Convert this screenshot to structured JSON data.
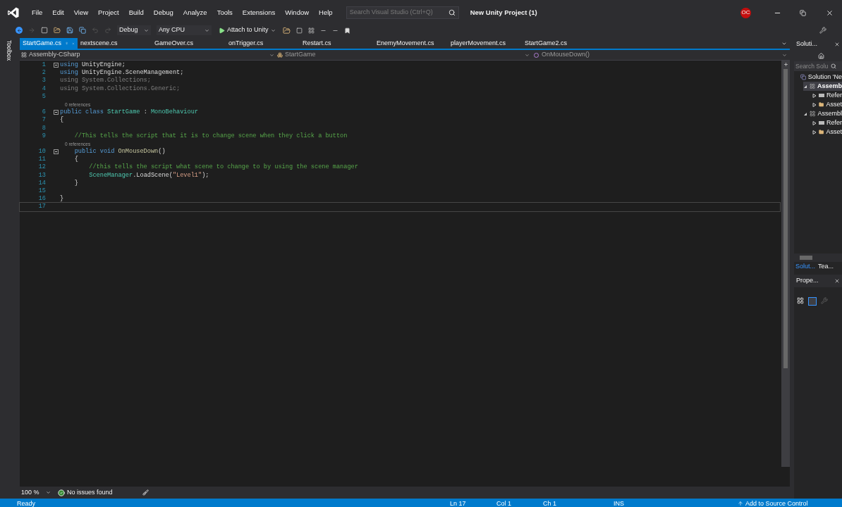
{
  "menu": [
    "File",
    "Edit",
    "View",
    "Project",
    "Build",
    "Debug",
    "Analyze",
    "Tools",
    "Extensions",
    "Window",
    "Help"
  ],
  "search": {
    "placeholder": "Search Visual Studio (Ctrl+Q)"
  },
  "window": {
    "title": "New Unity Project (1)"
  },
  "account": {
    "initials": "OC"
  },
  "toolbar": {
    "configuration": "Debug",
    "platform": "Any CPU",
    "run": "Attach to Unity"
  },
  "side_tab": "Toolbox",
  "tabs": [
    {
      "label": "StartGame.cs",
      "selected": true
    },
    {
      "label": "nextscene.cs",
      "selected": false
    },
    {
      "label": "GameOver.cs",
      "selected": false
    },
    {
      "label": "onTrigger.cs",
      "selected": false
    },
    {
      "label": "Restart.cs",
      "selected": false
    },
    {
      "label": "EnemyMovement.cs",
      "selected": false
    },
    {
      "label": "playerMovement.cs",
      "selected": false
    },
    {
      "label": "StartGame2.cs",
      "selected": false
    }
  ],
  "nav_bar": {
    "project": "Assembly-CSharp",
    "class": "StartGame",
    "member": "OnMouseDown()"
  },
  "code": [
    {
      "number": "1",
      "fold": true,
      "current": false,
      "tokens": [
        {
          "text": "using",
          "kind": "keyword"
        },
        {
          "text": " UnityEngine;",
          "kind": "plain"
        }
      ]
    },
    {
      "number": "2",
      "fold": false,
      "current": false,
      "tokens": [
        {
          "text": "using",
          "kind": "keyword"
        },
        {
          "text": " UnityEngine.SceneManagement;",
          "kind": "plain"
        }
      ]
    },
    {
      "number": "3",
      "fold": false,
      "current": false,
      "tokens": [
        {
          "text": "using System.Collections;",
          "kind": "unused"
        }
      ]
    },
    {
      "number": "4",
      "fold": false,
      "current": false,
      "tokens": [
        {
          "text": "using System.Collections.Generic;",
          "kind": "unused"
        }
      ]
    },
    {
      "number": "5",
      "fold": false,
      "current": false
    },
    {
      "number": "6",
      "fold": true,
      "current": false,
      "lens": "0 references",
      "tokens": [
        {
          "text": "public class ",
          "kind": "keyword"
        },
        {
          "text": "StartGame",
          "kind": "type"
        },
        {
          "text": " : ",
          "kind": "plain"
        },
        {
          "text": "MonoBehaviour",
          "kind": "type"
        }
      ]
    },
    {
      "number": "7",
      "fold": false,
      "current": false,
      "tokens": [
        {
          "text": "{",
          "kind": "plain"
        }
      ]
    },
    {
      "number": "8",
      "fold": false,
      "current": false
    },
    {
      "number": "9",
      "fold": false,
      "current": false,
      "tokens": [
        {
          "text": "    //This tells the script that it is to change scene when they click a button",
          "kind": "comment"
        }
      ]
    },
    {
      "number": "10",
      "fold": true,
      "current": false,
      "lens": "0 references",
      "tokens": [
        {
          "text": "    public void ",
          "kind": "keyword"
        },
        {
          "text": "OnMouseDown",
          "kind": "method"
        },
        {
          "text": "()",
          "kind": "plain"
        }
      ]
    },
    {
      "number": "11",
      "fold": false,
      "current": false,
      "tokens": [
        {
          "text": "    {",
          "kind": "plain"
        }
      ]
    },
    {
      "number": "12",
      "fold": false,
      "current": false,
      "tokens": [
        {
          "text": "        //this tells the script what scene to change to by using the scene manager",
          "kind": "comment"
        }
      ]
    },
    {
      "number": "13",
      "fold": false,
      "current": false,
      "tokens": [
        {
          "text": "        SceneManager",
          "kind": "type"
        },
        {
          "text": ".LoadScene(",
          "kind": "plain"
        },
        {
          "text": "\"Level1\"",
          "kind": "string"
        },
        {
          "text": ");",
          "kind": "plain"
        }
      ]
    },
    {
      "number": "14",
      "fold": false,
      "current": false,
      "tokens": [
        {
          "text": "    }",
          "kind": "plain"
        }
      ]
    },
    {
      "number": "15",
      "fold": false,
      "current": false
    },
    {
      "number": "16",
      "fold": false,
      "current": false,
      "tokens": [
        {
          "text": "}",
          "kind": "plain"
        }
      ]
    },
    {
      "number": "17",
      "fold": false,
      "current": true
    }
  ],
  "editor_footer": {
    "zoom": "100 %",
    "issues": "No issues found"
  },
  "solution_explorer": {
    "title": "Soluti...",
    "search": {
      "placeholder": "Search Solu"
    },
    "tree": [
      {
        "label": "Solution 'Ne",
        "kind": "solution",
        "children": [
          {
            "label": "Assemb",
            "kind": "project",
            "expanded": true,
            "selected": true,
            "children": [
              {
                "label": "Refer",
                "kind": "references",
                "expanded": false,
                "selected": false
              },
              {
                "label": "Asset",
                "kind": "folder",
                "expanded": false,
                "selected": false
              }
            ]
          },
          {
            "label": "Assembl",
            "kind": "project",
            "expanded": true,
            "selected": false,
            "children": [
              {
                "label": "Refer",
                "kind": "references",
                "expanded": false,
                "selected": false
              },
              {
                "label": "Asset",
                "kind": "folder",
                "expanded": false,
                "selected": false
              }
            ]
          }
        ]
      }
    ]
  },
  "panel_tabs": [
    {
      "label": "Solut...",
      "selected": true
    },
    {
      "label": "Tea...",
      "selected": false
    }
  ],
  "properties": {
    "title": "Prope..."
  },
  "status_bar": {
    "message": "Ready",
    "line": "Ln 17",
    "column": "Col 1",
    "char": "Ch 1",
    "mode": "INS",
    "source_control": "Add to Source Control"
  }
}
